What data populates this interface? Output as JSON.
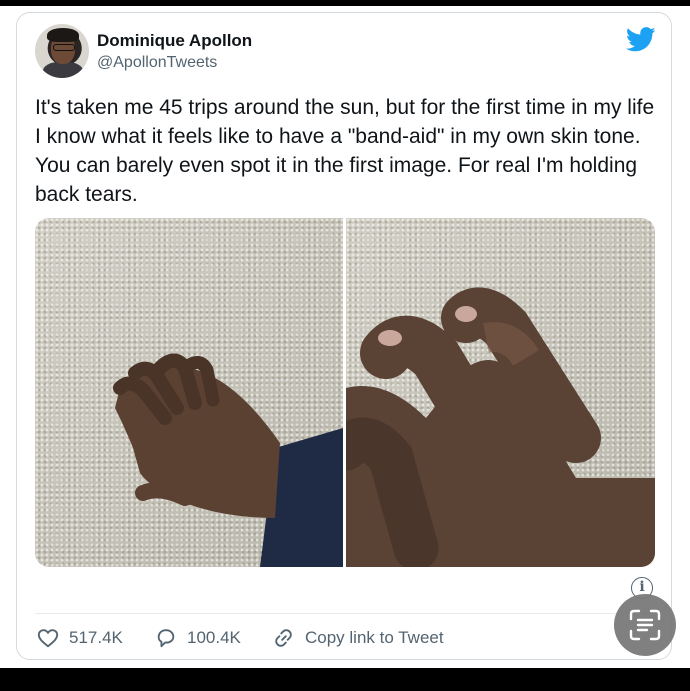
{
  "tweet": {
    "author": {
      "display_name": "Dominique Apollon",
      "handle": "@ApollonTweets",
      "avatar_icon": "profile-photo"
    },
    "brand_icon": "twitter-bird-icon",
    "brand_color": "#1da1f2",
    "text": "It's taken me 45 trips around the sun, but for the first time in my life I know what it feels like to have a \"band-aid\" in my own skin tone. You can barely even spot it in the first image. For real I'm holding back tears.",
    "media": [
      {
        "icon": "photo-hand-on-carpet"
      },
      {
        "icon": "photo-hand-closeup-bandage"
      }
    ],
    "actions": {
      "likes": "517.4K",
      "replies": "100.4K",
      "copy_link_label": "Copy link to Tweet"
    }
  },
  "overlay": {
    "info_glyph": "i",
    "scan_icon": "text-scan-icon"
  }
}
